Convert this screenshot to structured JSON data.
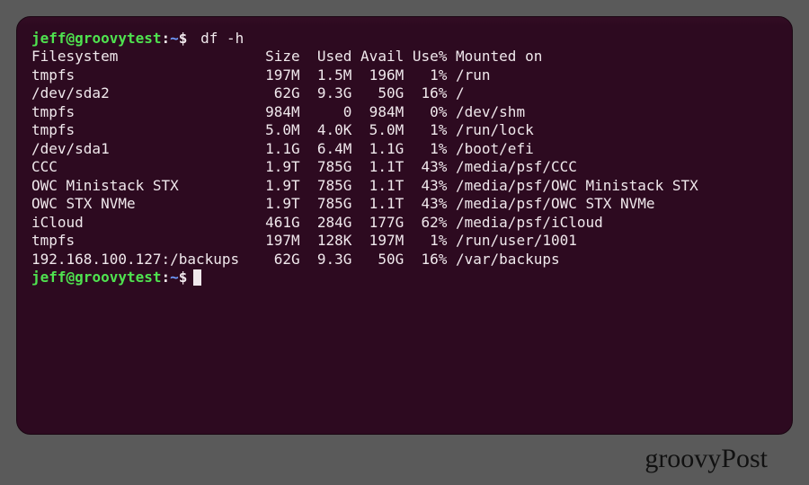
{
  "prompt": {
    "user": "jeff",
    "at": "@",
    "host": "groovytest",
    "colon": ":",
    "path": "~",
    "dollar": "$"
  },
  "command": "df -h",
  "df": {
    "headers": {
      "filesystem": "Filesystem",
      "size": "Size",
      "used": "Used",
      "avail": "Avail",
      "usepct": "Use%",
      "mounted": "Mounted on"
    },
    "rows": [
      {
        "filesystem": "tmpfs",
        "size": "197M",
        "used": "1.5M",
        "avail": "196M",
        "usepct": "1%",
        "mounted": "/run"
      },
      {
        "filesystem": "/dev/sda2",
        "size": "62G",
        "used": "9.3G",
        "avail": "50G",
        "usepct": "16%",
        "mounted": "/"
      },
      {
        "filesystem": "tmpfs",
        "size": "984M",
        "used": "0",
        "avail": "984M",
        "usepct": "0%",
        "mounted": "/dev/shm"
      },
      {
        "filesystem": "tmpfs",
        "size": "5.0M",
        "used": "4.0K",
        "avail": "5.0M",
        "usepct": "1%",
        "mounted": "/run/lock"
      },
      {
        "filesystem": "/dev/sda1",
        "size": "1.1G",
        "used": "6.4M",
        "avail": "1.1G",
        "usepct": "1%",
        "mounted": "/boot/efi"
      },
      {
        "filesystem": "CCC",
        "size": "1.9T",
        "used": "785G",
        "avail": "1.1T",
        "usepct": "43%",
        "mounted": "/media/psf/CCC"
      },
      {
        "filesystem": "OWC Ministack STX",
        "size": "1.9T",
        "used": "785G",
        "avail": "1.1T",
        "usepct": "43%",
        "mounted": "/media/psf/OWC Ministack STX"
      },
      {
        "filesystem": "OWC STX NVMe",
        "size": "1.9T",
        "used": "785G",
        "avail": "1.1T",
        "usepct": "43%",
        "mounted": "/media/psf/OWC STX NVMe"
      },
      {
        "filesystem": "iCloud",
        "size": "461G",
        "used": "284G",
        "avail": "177G",
        "usepct": "62%",
        "mounted": "/media/psf/iCloud"
      },
      {
        "filesystem": "tmpfs",
        "size": "197M",
        "used": "128K",
        "avail": "197M",
        "usepct": "1%",
        "mounted": "/run/user/1001"
      },
      {
        "filesystem": "192.168.100.127:/backups",
        "size": "62G",
        "used": "9.3G",
        "avail": "50G",
        "usepct": "16%",
        "mounted": "/var/backups"
      }
    ]
  },
  "columns": {
    "fs": 25,
    "size": 6,
    "used": 6,
    "avail": 6,
    "usepct": 5
  },
  "watermark": "groovyPost",
  "colors": {
    "bg": "#2d0a20",
    "fg": "#f0e8ec",
    "user": "#4fe24f",
    "path": "#6f9cff"
  }
}
